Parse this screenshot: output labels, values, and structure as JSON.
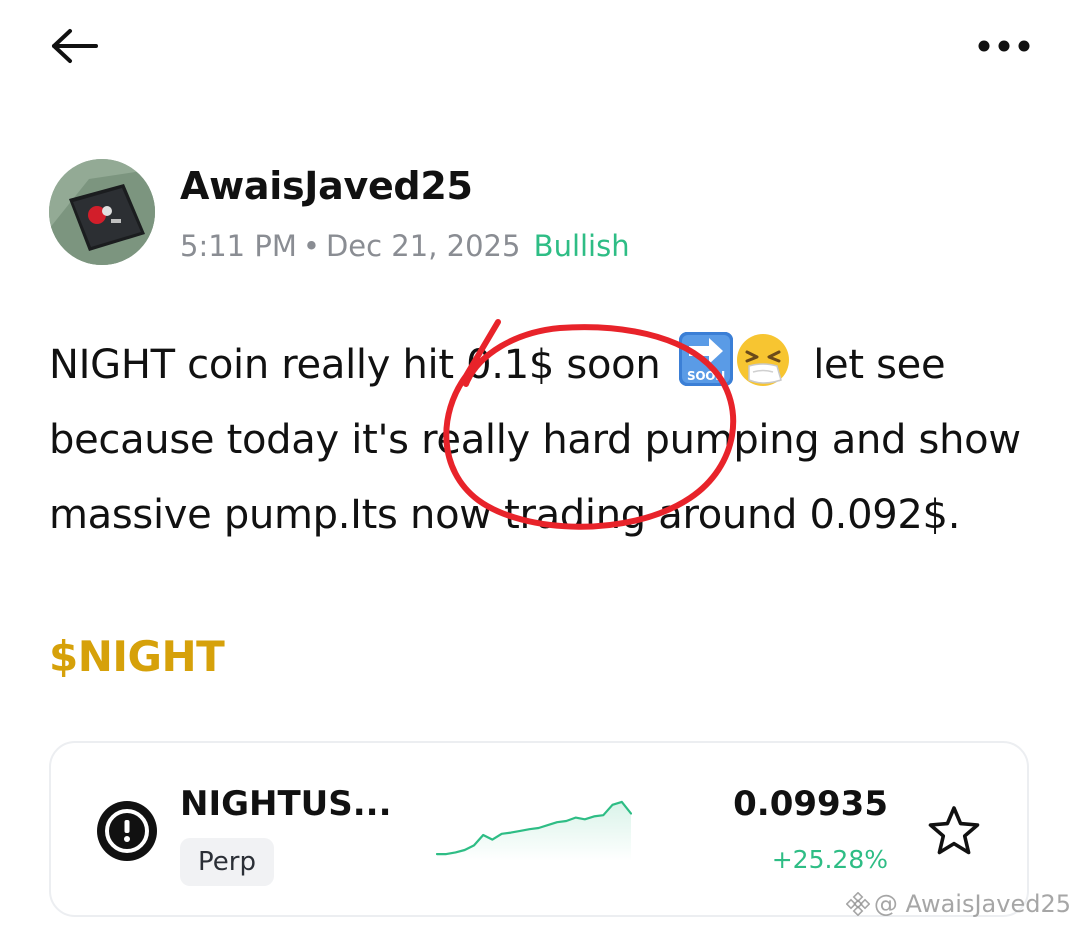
{
  "post": {
    "author": "AwaisJaved25",
    "time": "5:11 PM",
    "separator": "•",
    "date": "Dec 21, 2025",
    "sentiment": "Bullish",
    "body_part1": "NIGHT coin really hit 0.1$ soon ",
    "body_part2": " let see because today it's really hard pumping and show massive pump.Its now trading around 0.092$.",
    "cashtag": "$NIGHT"
  },
  "ticker": {
    "symbol": "NIGHTUS...",
    "type": "Perp",
    "price": "0.09935",
    "change": "+25.28%",
    "sparkline": [
      0.05,
      0.05,
      0.08,
      0.12,
      0.2,
      0.38,
      0.3,
      0.4,
      0.42,
      0.45,
      0.48,
      0.5,
      0.55,
      0.6,
      0.62,
      0.68,
      0.65,
      0.7,
      0.72,
      0.9,
      0.95,
      0.75
    ]
  },
  "watermark": "@ AwaisJaved25",
  "colors": {
    "bullish": "#2ebd85",
    "cashtag": "#d6a10a",
    "annotation": "#e8232a",
    "muted": "#8a8d93"
  },
  "icons": {
    "back": "arrow-left-icon",
    "more": "more-horizontal-icon",
    "soon": "soon-arrow-emoji",
    "face": "sneezing-face-emoji",
    "token": "night-token-icon",
    "favorite": "star-outline-icon"
  }
}
